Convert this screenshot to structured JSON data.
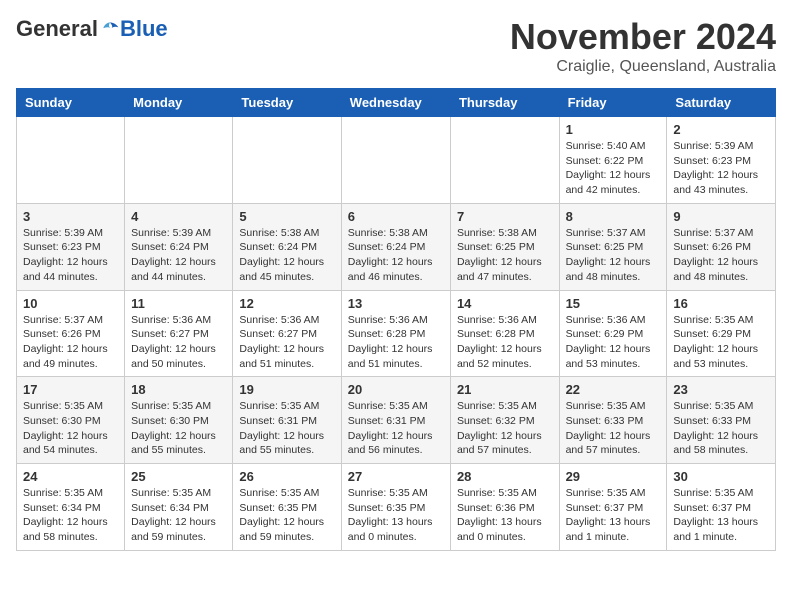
{
  "header": {
    "logo_general": "General",
    "logo_blue": "Blue",
    "month_title": "November 2024",
    "location": "Craiglie, Queensland, Australia"
  },
  "weekdays": [
    "Sunday",
    "Monday",
    "Tuesday",
    "Wednesday",
    "Thursday",
    "Friday",
    "Saturday"
  ],
  "weeks": [
    [
      {
        "day": "",
        "info": ""
      },
      {
        "day": "",
        "info": ""
      },
      {
        "day": "",
        "info": ""
      },
      {
        "day": "",
        "info": ""
      },
      {
        "day": "",
        "info": ""
      },
      {
        "day": "1",
        "info": "Sunrise: 5:40 AM\nSunset: 6:22 PM\nDaylight: 12 hours\nand 42 minutes."
      },
      {
        "day": "2",
        "info": "Sunrise: 5:39 AM\nSunset: 6:23 PM\nDaylight: 12 hours\nand 43 minutes."
      }
    ],
    [
      {
        "day": "3",
        "info": "Sunrise: 5:39 AM\nSunset: 6:23 PM\nDaylight: 12 hours\nand 44 minutes."
      },
      {
        "day": "4",
        "info": "Sunrise: 5:39 AM\nSunset: 6:24 PM\nDaylight: 12 hours\nand 44 minutes."
      },
      {
        "day": "5",
        "info": "Sunrise: 5:38 AM\nSunset: 6:24 PM\nDaylight: 12 hours\nand 45 minutes."
      },
      {
        "day": "6",
        "info": "Sunrise: 5:38 AM\nSunset: 6:24 PM\nDaylight: 12 hours\nand 46 minutes."
      },
      {
        "day": "7",
        "info": "Sunrise: 5:38 AM\nSunset: 6:25 PM\nDaylight: 12 hours\nand 47 minutes."
      },
      {
        "day": "8",
        "info": "Sunrise: 5:37 AM\nSunset: 6:25 PM\nDaylight: 12 hours\nand 48 minutes."
      },
      {
        "day": "9",
        "info": "Sunrise: 5:37 AM\nSunset: 6:26 PM\nDaylight: 12 hours\nand 48 minutes."
      }
    ],
    [
      {
        "day": "10",
        "info": "Sunrise: 5:37 AM\nSunset: 6:26 PM\nDaylight: 12 hours\nand 49 minutes."
      },
      {
        "day": "11",
        "info": "Sunrise: 5:36 AM\nSunset: 6:27 PM\nDaylight: 12 hours\nand 50 minutes."
      },
      {
        "day": "12",
        "info": "Sunrise: 5:36 AM\nSunset: 6:27 PM\nDaylight: 12 hours\nand 51 minutes."
      },
      {
        "day": "13",
        "info": "Sunrise: 5:36 AM\nSunset: 6:28 PM\nDaylight: 12 hours\nand 51 minutes."
      },
      {
        "day": "14",
        "info": "Sunrise: 5:36 AM\nSunset: 6:28 PM\nDaylight: 12 hours\nand 52 minutes."
      },
      {
        "day": "15",
        "info": "Sunrise: 5:36 AM\nSunset: 6:29 PM\nDaylight: 12 hours\nand 53 minutes."
      },
      {
        "day": "16",
        "info": "Sunrise: 5:35 AM\nSunset: 6:29 PM\nDaylight: 12 hours\nand 53 minutes."
      }
    ],
    [
      {
        "day": "17",
        "info": "Sunrise: 5:35 AM\nSunset: 6:30 PM\nDaylight: 12 hours\nand 54 minutes."
      },
      {
        "day": "18",
        "info": "Sunrise: 5:35 AM\nSunset: 6:30 PM\nDaylight: 12 hours\nand 55 minutes."
      },
      {
        "day": "19",
        "info": "Sunrise: 5:35 AM\nSunset: 6:31 PM\nDaylight: 12 hours\nand 55 minutes."
      },
      {
        "day": "20",
        "info": "Sunrise: 5:35 AM\nSunset: 6:31 PM\nDaylight: 12 hours\nand 56 minutes."
      },
      {
        "day": "21",
        "info": "Sunrise: 5:35 AM\nSunset: 6:32 PM\nDaylight: 12 hours\nand 57 minutes."
      },
      {
        "day": "22",
        "info": "Sunrise: 5:35 AM\nSunset: 6:33 PM\nDaylight: 12 hours\nand 57 minutes."
      },
      {
        "day": "23",
        "info": "Sunrise: 5:35 AM\nSunset: 6:33 PM\nDaylight: 12 hours\nand 58 minutes."
      }
    ],
    [
      {
        "day": "24",
        "info": "Sunrise: 5:35 AM\nSunset: 6:34 PM\nDaylight: 12 hours\nand 58 minutes."
      },
      {
        "day": "25",
        "info": "Sunrise: 5:35 AM\nSunset: 6:34 PM\nDaylight: 12 hours\nand 59 minutes."
      },
      {
        "day": "26",
        "info": "Sunrise: 5:35 AM\nSunset: 6:35 PM\nDaylight: 12 hours\nand 59 minutes."
      },
      {
        "day": "27",
        "info": "Sunrise: 5:35 AM\nSunset: 6:35 PM\nDaylight: 13 hours\nand 0 minutes."
      },
      {
        "day": "28",
        "info": "Sunrise: 5:35 AM\nSunset: 6:36 PM\nDaylight: 13 hours\nand 0 minutes."
      },
      {
        "day": "29",
        "info": "Sunrise: 5:35 AM\nSunset: 6:37 PM\nDaylight: 13 hours\nand 1 minute."
      },
      {
        "day": "30",
        "info": "Sunrise: 5:35 AM\nSunset: 6:37 PM\nDaylight: 13 hours\nand 1 minute."
      }
    ]
  ]
}
